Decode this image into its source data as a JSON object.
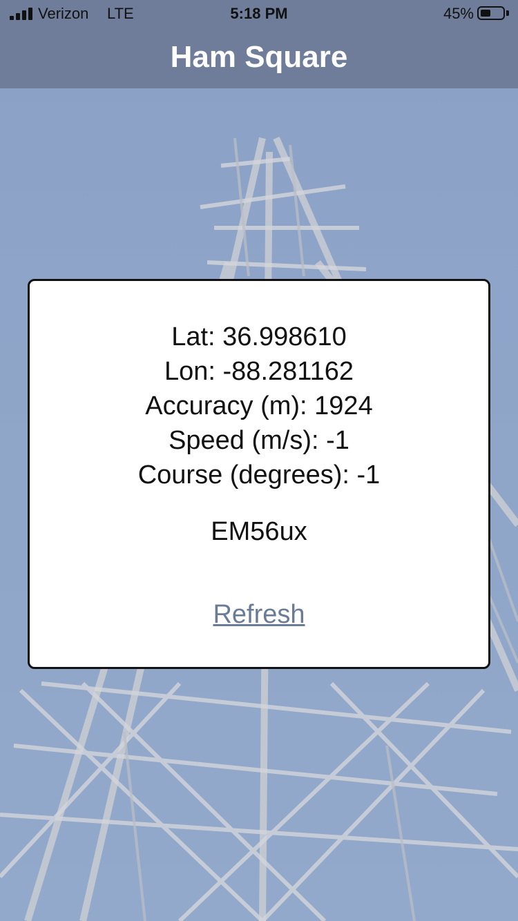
{
  "status_bar": {
    "carrier": "Verizon",
    "network": "LTE",
    "time": "5:18 PM",
    "battery_percent": "45%",
    "battery_level": 0.45,
    "icons": [
      "signal-icon",
      "battery-icon"
    ]
  },
  "nav": {
    "title": "Ham Square"
  },
  "location": {
    "lat": "Lat: 36.998610",
    "lon": "Lon: -88.281162",
    "accuracy": "Accuracy (m): 1924",
    "speed": "Speed (m/s): -1",
    "course": "Course (degrees): -1"
  },
  "grid_square": "EM56ux",
  "actions": {
    "refresh_label": "Refresh"
  },
  "colors": {
    "nav_background": "#6c7a96",
    "link": "#6a7b98",
    "sky": "#8ea2c4"
  }
}
